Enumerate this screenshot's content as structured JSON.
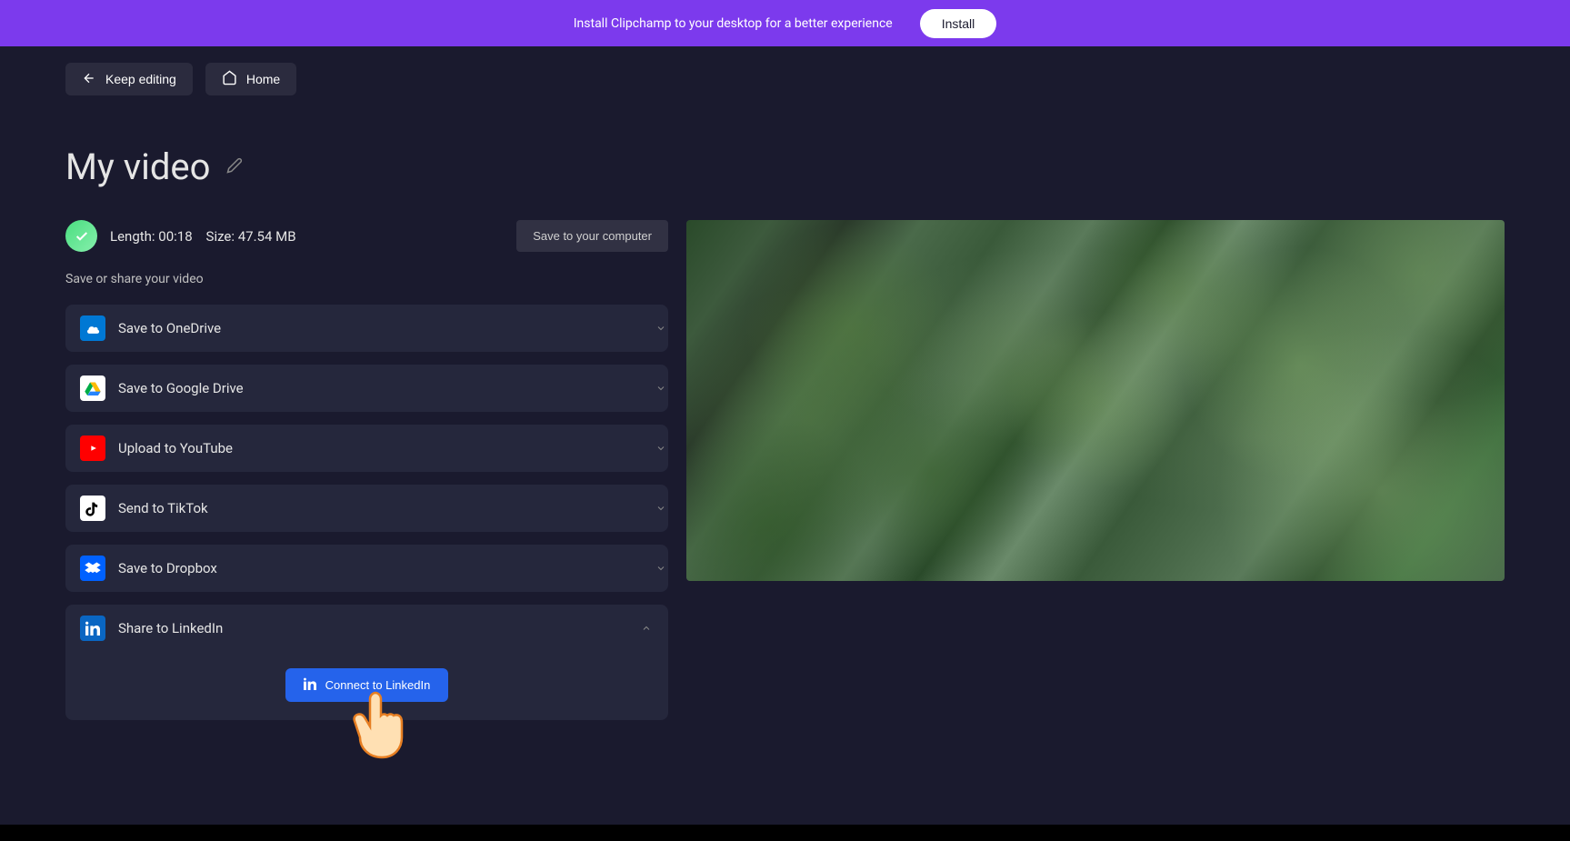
{
  "banner": {
    "text": "Install Clipchamp to your desktop for a better experience",
    "button": "Install"
  },
  "nav": {
    "keep_editing": "Keep editing",
    "home": "Home"
  },
  "video": {
    "title": "My video",
    "length_label": "Length:",
    "length_value": "00:18",
    "size_label": "Size:",
    "size_value": "47.54 MB"
  },
  "actions": {
    "save_computer": "Save to your computer",
    "share_label": "Save or share your video"
  },
  "share_options": [
    {
      "label": "Save to OneDrive"
    },
    {
      "label": "Save to Google Drive"
    },
    {
      "label": "Upload to YouTube"
    },
    {
      "label": "Send to TikTok"
    },
    {
      "label": "Save to Dropbox"
    },
    {
      "label": "Share to LinkedIn"
    }
  ],
  "linkedin": {
    "connect": "Connect to LinkedIn"
  }
}
